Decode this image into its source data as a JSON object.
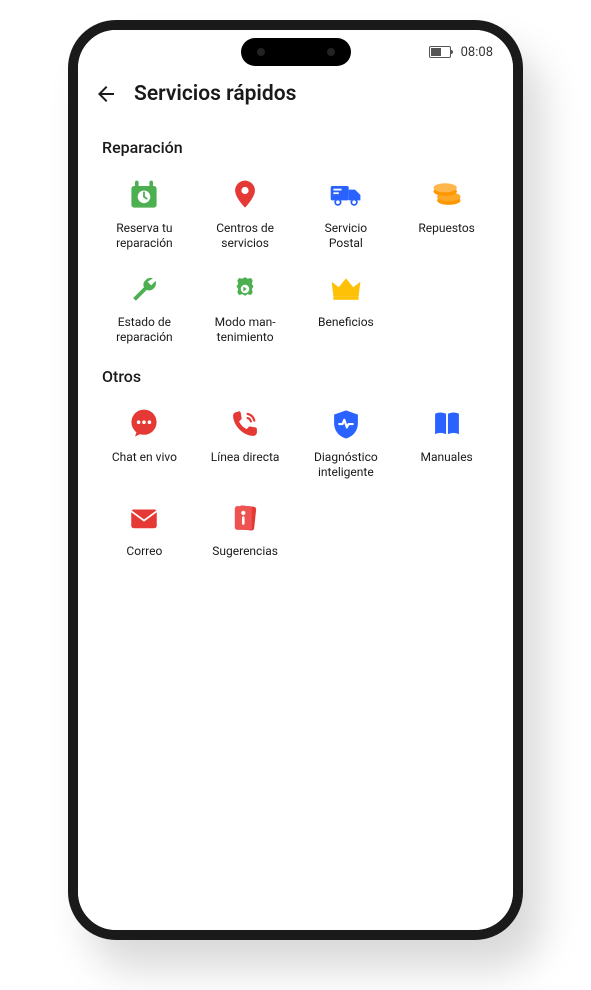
{
  "statusbar": {
    "time": "08:08"
  },
  "header": {
    "title": "Servicios rápidos"
  },
  "sections": {
    "repair": {
      "title": "Reparación",
      "items": [
        {
          "label": "Reserva tu\nreparación"
        },
        {
          "label": "Centros de\nservicios"
        },
        {
          "label": "Servicio\nPostal"
        },
        {
          "label": "Repuestos"
        },
        {
          "label": "Estado de\nreparación"
        },
        {
          "label": "Modo man-\ntenimiento"
        },
        {
          "label": "Beneficios"
        }
      ]
    },
    "others": {
      "title": "Otros",
      "items": [
        {
          "label": "Chat en vivo"
        },
        {
          "label": "Línea directa"
        },
        {
          "label": "Diagnóstico\ninteligente"
        },
        {
          "label": "Manuales"
        },
        {
          "label": "Correo"
        },
        {
          "label": "Sugerencias"
        }
      ]
    }
  },
  "colors": {
    "green": "#4CAF50",
    "red": "#E53935",
    "blue": "#2962FF",
    "orange": "#FF9800",
    "yellow": "#FFC107"
  }
}
